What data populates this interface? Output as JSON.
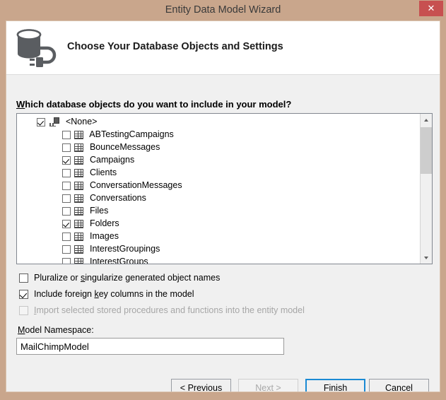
{
  "window": {
    "title": "Entity Data Model Wizard",
    "close_label": "✕",
    "close_icon": "close-icon",
    "border_color": "#c9a68c",
    "close_button_color": "#c75050"
  },
  "header": {
    "icon": "database-connection-icon",
    "title": "Choose Your Database Objects and Settings"
  },
  "body": {
    "prompt_before": "W",
    "prompt_accel": "W",
    "prompt_rest": "hich database objects do you want to include in your model?",
    "prompt_full": "Which database objects do you want to include in your model?"
  },
  "tree": {
    "root": {
      "label": "<None>",
      "checked": true,
      "expanded": true,
      "icon": "server-icon"
    },
    "items": [
      {
        "label": "ABTestingCampaigns",
        "checked": false,
        "icon": "table-icon"
      },
      {
        "label": "BounceMessages",
        "checked": false,
        "icon": "table-icon"
      },
      {
        "label": "Campaigns",
        "checked": true,
        "icon": "table-icon"
      },
      {
        "label": "Clients",
        "checked": false,
        "icon": "table-icon"
      },
      {
        "label": "ConversationMessages",
        "checked": false,
        "icon": "table-icon"
      },
      {
        "label": "Conversations",
        "checked": false,
        "icon": "table-icon"
      },
      {
        "label": "Files",
        "checked": false,
        "icon": "table-icon"
      },
      {
        "label": "Folders",
        "checked": true,
        "icon": "table-icon"
      },
      {
        "label": "Images",
        "checked": false,
        "icon": "table-icon"
      },
      {
        "label": "InterestGroupings",
        "checked": false,
        "icon": "table-icon"
      },
      {
        "label": "InterestGroups",
        "checked": false,
        "icon": "table-icon"
      }
    ],
    "scrollbar": {
      "up_arrow": "scroll-up-icon",
      "down_arrow": "scroll-down-icon"
    }
  },
  "options": {
    "pluralize": {
      "label_a": "Pluralize or ",
      "accel": "s",
      "label_b": "ingularize generated object names",
      "checked": false,
      "enabled": true
    },
    "foreign_key": {
      "label_a": "Include foreign ",
      "accel": "k",
      "label_b": "ey columns in the model",
      "checked": true,
      "enabled": true
    },
    "import_procs": {
      "label_a": "",
      "accel": "I",
      "label_b": "mport selected stored procedures and functions into the entity model",
      "checked": false,
      "enabled": false
    }
  },
  "namespace": {
    "label_a": "",
    "accel": "M",
    "label_b": "odel Namespace:",
    "label_full": "Model Namespace:",
    "value": "MailChimpModel",
    "placeholder": ""
  },
  "buttons": {
    "previous": {
      "prefix": "< ",
      "accel": "P",
      "rest": "revious",
      "label": "< Previous",
      "enabled": true,
      "default": false
    },
    "next": {
      "prefix": "",
      "accel": "N",
      "rest": "ext >",
      "label": "Next >",
      "enabled": false,
      "default": false
    },
    "finish": {
      "prefix": "",
      "accel": "F",
      "rest": "inish",
      "label": "Finish",
      "enabled": true,
      "default": true
    },
    "cancel": {
      "prefix": "",
      "accel": "",
      "rest": "Cancel",
      "label": "Cancel",
      "enabled": true,
      "default": false
    }
  }
}
